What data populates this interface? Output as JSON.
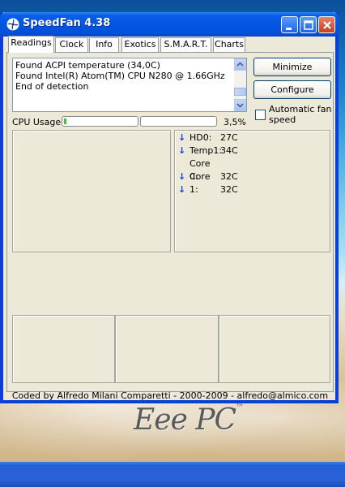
{
  "window": {
    "title": "SpeedFan 4.38"
  },
  "tabs": [
    {
      "label": "Readings",
      "active": true
    },
    {
      "label": "Clock",
      "active": false
    },
    {
      "label": "Info",
      "active": false
    },
    {
      "label": "Exotics",
      "active": false
    },
    {
      "label": "S.M.A.R.T.",
      "active": false
    },
    {
      "label": "Charts",
      "active": false
    }
  ],
  "log": {
    "lines": [
      "Found ACPI temperature (34,0C)",
      "Found Intel(R) Atom(TM) CPU N280 @ 1.66GHz",
      "End of detection"
    ]
  },
  "buttons": {
    "minimize": "Minimize",
    "configure": "Configure"
  },
  "auto_fan": {
    "label": "Automatic fan speed",
    "checked": false
  },
  "cpu": {
    "label": "CPU Usage",
    "percent_text": "3,5%",
    "core1_fraction": 0.035,
    "core2_fraction": 0.0
  },
  "temperatures": [
    {
      "name": "HD0:",
      "value": "27C",
      "trend": "down"
    },
    {
      "name": "Temp1:",
      "value": "34C",
      "trend": "down"
    },
    {
      "name": "Core 0:",
      "value": "32C",
      "trend": "down"
    },
    {
      "name": "Core 1:",
      "value": "32C",
      "trend": "down"
    }
  ],
  "status": {
    "text": "Coded by Alfredo Milani Comparetti - 2000-2009 - alfredo@almico.com"
  },
  "desktop": {
    "logo_text": "Eee PC",
    "logo_tm": "™"
  },
  "colors": {
    "titlebar": "#0456e2",
    "window_bg": "#ece9d8",
    "cpu_fill": "#2fca2f",
    "temp_arrow": "#0a3fd8"
  },
  "icons": {
    "app": "fan-icon",
    "minimize": "minimize-icon",
    "maximize": "maximize-icon",
    "close": "close-icon",
    "trend": "arrow-down-icon"
  }
}
